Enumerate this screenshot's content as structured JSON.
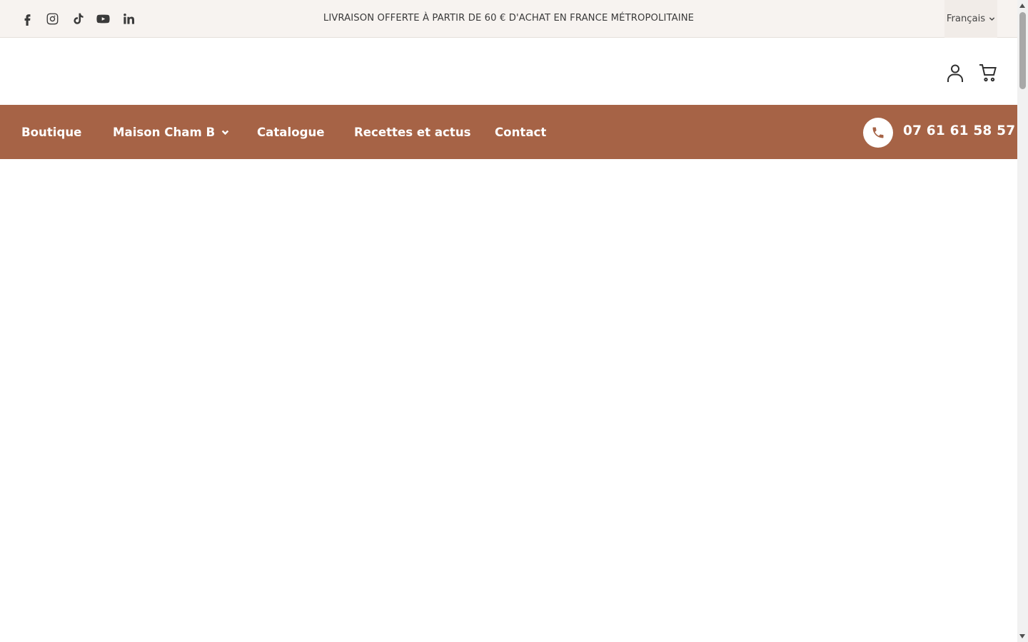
{
  "topbar": {
    "social_icons": [
      "facebook-icon",
      "instagram-icon",
      "tiktok-icon",
      "youtube-icon",
      "linkedin-icon"
    ],
    "announcement": "LIVRAISON OFFERTE À PARTIR DE 60 € D'ACHAT EN FRANCE MÉTROPOLITAINE",
    "language": "Français"
  },
  "header": {
    "icons": [
      "account-icon",
      "cart-icon"
    ]
  },
  "nav": {
    "items": [
      {
        "label": "Boutique"
      },
      {
        "label": "Maison Cham B",
        "has_dropdown": true
      },
      {
        "label": "Catalogue"
      },
      {
        "label": "Recettes et actus"
      },
      {
        "label": "Contact"
      }
    ],
    "phone": "07 61 61 58 57"
  },
  "colors": {
    "nav_background": "#a66346",
    "topbar_background": "#f7f3f0"
  }
}
